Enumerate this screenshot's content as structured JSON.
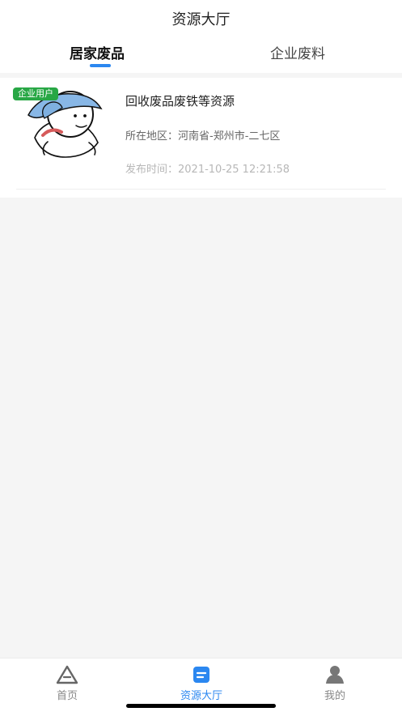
{
  "header": {
    "title": "资源大厅",
    "tabs": [
      {
        "label": "居家废品"
      },
      {
        "label": "企业废料"
      }
    ]
  },
  "card": {
    "badge": "企业用户",
    "title": "回收废品废铁等资源",
    "region": "所在地区：河南省-郑州市-二七区",
    "time": "发布时间：2021-10-25 12:21:58",
    "avatar_icon": "cartoon-avatar-icon"
  },
  "bottom_nav": {
    "items": [
      {
        "label": "首页",
        "icon": "home-triangle-icon"
      },
      {
        "label": "资源大厅",
        "icon": "resource-hall-icon"
      },
      {
        "label": "我的",
        "icon": "profile-icon"
      }
    ]
  },
  "colors": {
    "accent": "#2b87f0",
    "badge": "#28a745"
  }
}
